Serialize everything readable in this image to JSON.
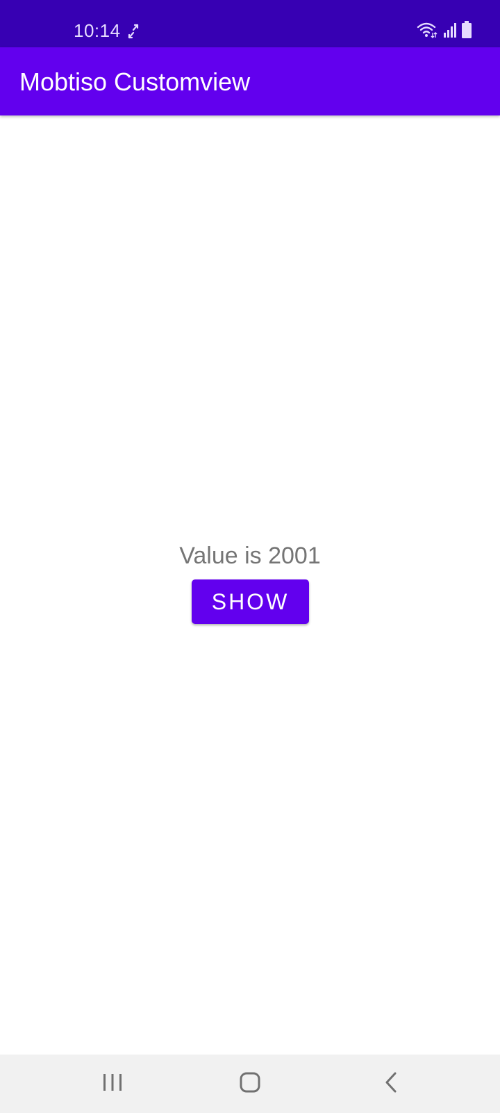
{
  "status_bar": {
    "time": "10:14",
    "icons": [
      "sync-icon",
      "wifi-icon",
      "signal-icon",
      "battery-icon"
    ],
    "background": "#3700b3"
  },
  "app_bar": {
    "title": "Mobtiso Customview",
    "background": "#6200ee"
  },
  "main": {
    "value_text": "Value is 2001",
    "show_button_label": "SHOW",
    "accent": "#6200ee"
  },
  "nav_bar": {
    "items": [
      "recents-icon",
      "home-icon",
      "back-icon"
    ]
  }
}
